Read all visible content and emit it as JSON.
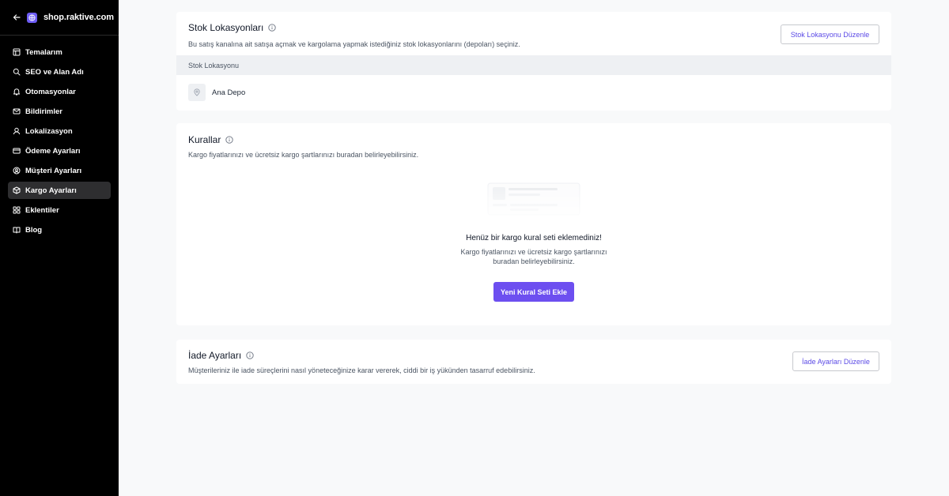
{
  "sidebar": {
    "store_name": "shop.raktive.com",
    "items": [
      {
        "label": "Temalarım",
        "icon": "layout-icon"
      },
      {
        "label": "SEO ve Alan Adı",
        "icon": "search-icon"
      },
      {
        "label": "Otomasyonlar",
        "icon": "bell-icon"
      },
      {
        "label": "Bildirimler",
        "icon": "mail-icon"
      },
      {
        "label": "Lokalizasyon",
        "icon": "user-pin-icon"
      },
      {
        "label": "Ödeme Ayarları",
        "icon": "credit-card-icon"
      },
      {
        "label": "Müşteri Ayarları",
        "icon": "user-circle-icon"
      },
      {
        "label": "Kargo Ayarları",
        "icon": "box-icon",
        "active": true
      },
      {
        "label": "Eklentiler",
        "icon": "grid-icon"
      },
      {
        "label": "Blog",
        "icon": "book-icon"
      }
    ]
  },
  "stock": {
    "title": "Stok Lokasyonları",
    "subtitle": "Bu satış kanalına ait satışa açmak ve kargolama yapmak istediğiniz stok lokasyonlarını (depoları) seçiniz.",
    "edit_button": "Stok Lokasyonu Düzenle",
    "column_header": "Stok Lokasyonu",
    "locations": [
      "Ana Depo"
    ]
  },
  "rules": {
    "title": "Kurallar",
    "subtitle": "Kargo fiyatlarınızı ve ücretsiz kargo şartlarınızı buradan belirleyebilirsiniz.",
    "empty_title": "Henüz bir kargo kural seti eklemediniz!",
    "empty_desc": "Kargo fiyatlarınızı ve ücretsiz kargo şartlarınızı buradan belirleyebilirsiniz.",
    "add_button": "Yeni Kural Seti Ekle"
  },
  "returns": {
    "title": "İade Ayarları",
    "subtitle": "Müşterileriniz ile iade süreçlerini nasıl yöneteceğinize karar vererek, ciddi bir iş yükünden tasarruf edebilirsiniz.",
    "edit_button": "İade Ayarları Düzenle"
  },
  "colors": {
    "accent": "#6d4ff0",
    "sidebar_bg": "#000000",
    "active_item_bg": "#2e2e30",
    "page_bg": "#f8f9fa"
  }
}
